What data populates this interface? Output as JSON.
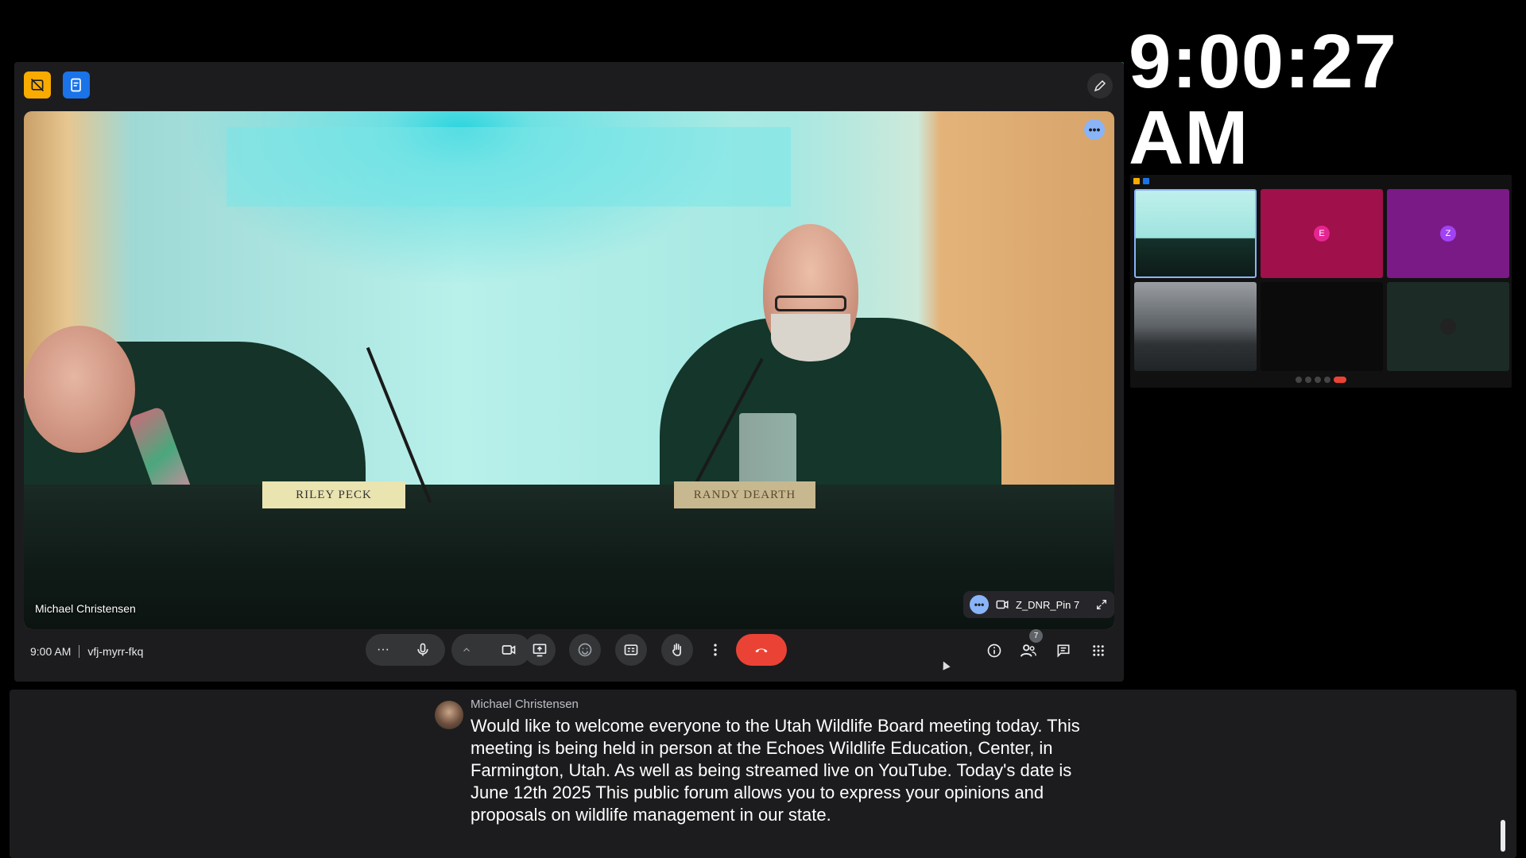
{
  "clock": {
    "time": "9:00:27 AM"
  },
  "meeting": {
    "time": "9:00 AM",
    "code": "vfj-myrr-fkq",
    "speaker_name": "Michael Christensen",
    "participant_count": "7"
  },
  "pin_chip": {
    "label": "Z_DNR_Pin 7"
  },
  "nameplates": {
    "left": "RILEY PECK",
    "right": "RANDY DEARTH"
  },
  "thumbnails": [
    {
      "initial": "",
      "color": "#0c3a35"
    },
    {
      "initial": "E",
      "color": "#a0104a",
      "avatar_color": "#e52592"
    },
    {
      "initial": "Z",
      "color": "#7a1a86",
      "avatar_color": "#a142f4"
    },
    {
      "initial": "",
      "color": "#6f7378"
    },
    {
      "initial": "",
      "color": "#0b0b0b"
    },
    {
      "initial": "",
      "color": "#1c2b26"
    }
  ],
  "captions": {
    "speaker": "Michael Christensen",
    "text": "Would like to welcome everyone to the Utah Wildlife Board meeting today. This meeting is being held in person at the Echoes Wildlife Education, Center, in Farmington, Utah. As well as being streamed live on YouTube. Today's date is June 12th 2025 This public forum allows you to express your opinions and proposals on wildlife management in our state."
  },
  "colors": {
    "end_call": "#ea4335",
    "accent_blue": "#1a73e8",
    "accent_yellow": "#f9ab00",
    "chip_blue": "#8ab4f8"
  }
}
